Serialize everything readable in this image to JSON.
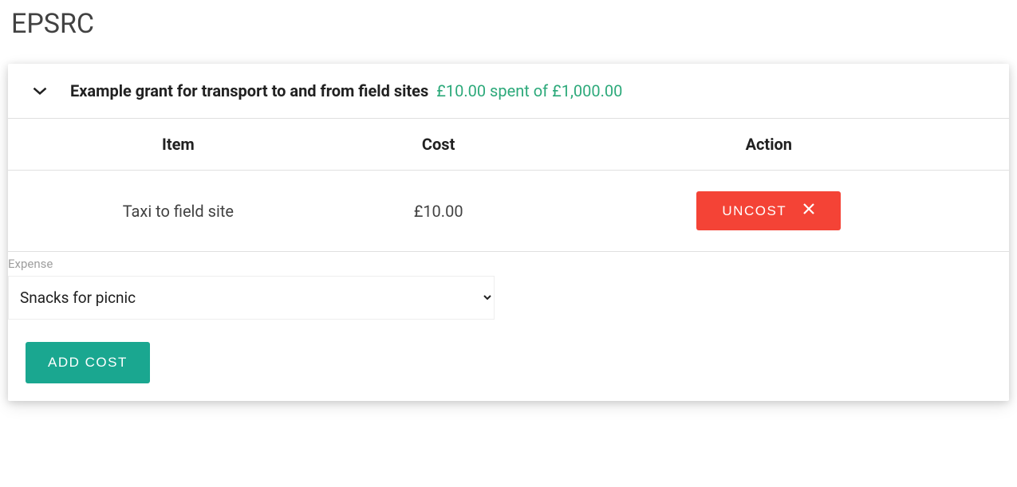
{
  "page": {
    "title": "EPSRC"
  },
  "grant": {
    "name": "Example grant for transport to and from field sites",
    "spent_text": "£10.00 spent of £1,000.00"
  },
  "table": {
    "headers": {
      "item": "Item",
      "cost": "Cost",
      "action": "Action"
    },
    "rows": [
      {
        "item": "Taxi to field site",
        "cost": "£10.00",
        "action_label": "UNCOST"
      }
    ]
  },
  "form": {
    "expense_label": "Expense",
    "expense_selected": "Snacks for picnic",
    "add_cost_label": "ADD COST"
  }
}
